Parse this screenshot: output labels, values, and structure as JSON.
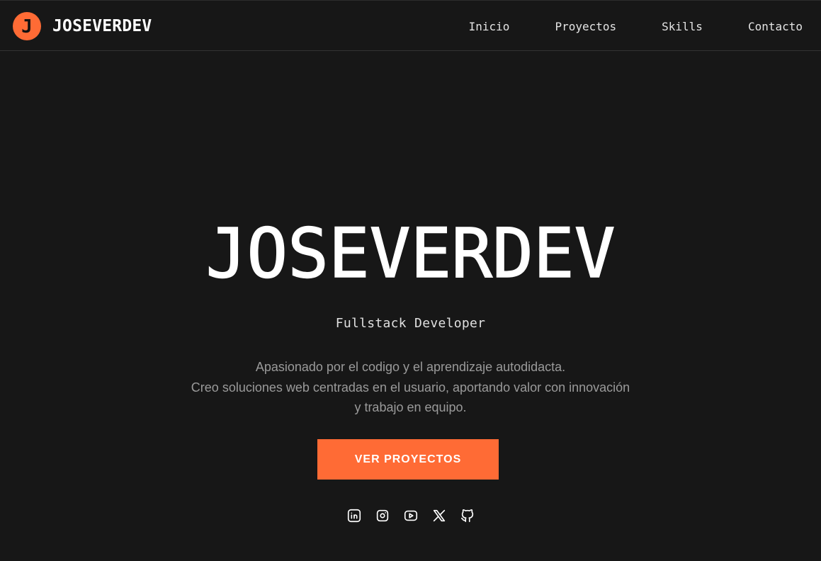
{
  "header": {
    "logo_letter": "J",
    "brand": "JOSEVERDEV",
    "nav": [
      {
        "label": "Inicio"
      },
      {
        "label": "Proyectos"
      },
      {
        "label": "Skills"
      },
      {
        "label": "Contacto"
      }
    ]
  },
  "hero": {
    "title": "JOSEVERDEV",
    "subtitle": "Fullstack Developer",
    "description_lines": [
      "Apasionado por el codigo y el aprendizaje autodidacta.",
      "Creo soluciones web centradas en el usuario, aportando valor con innovación",
      "y trabajo en equipo."
    ],
    "cta_label": "VER PROYECTOS",
    "socials": [
      {
        "icon": "linkedin-icon"
      },
      {
        "icon": "instagram-icon"
      },
      {
        "icon": "youtube-icon"
      },
      {
        "icon": "x-twitter-icon"
      },
      {
        "icon": "github-icon"
      }
    ]
  },
  "colors": {
    "background": "#171717",
    "accent": "#ff6b35",
    "text": "#ffffff",
    "muted": "#9a9a9a"
  }
}
